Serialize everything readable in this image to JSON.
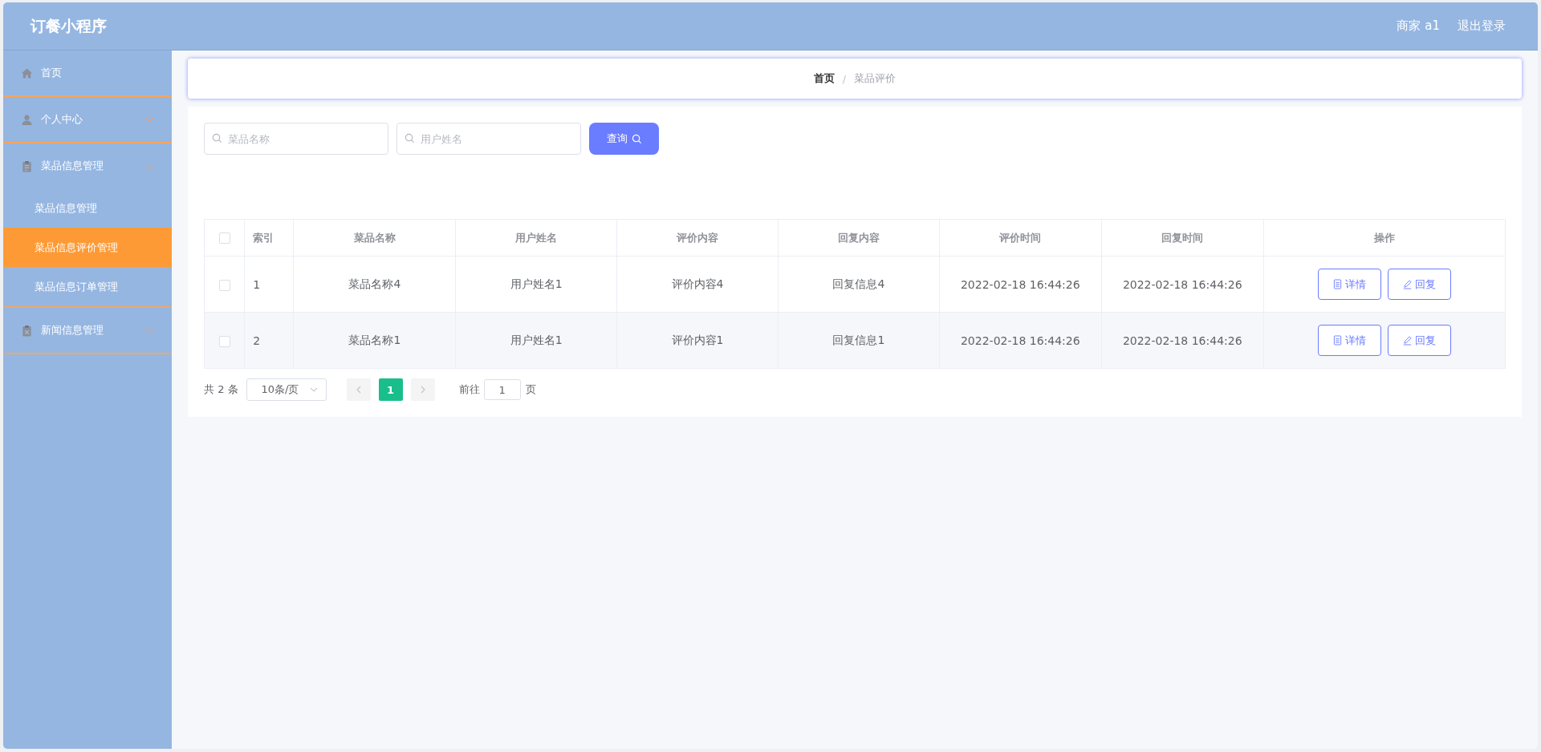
{
  "header": {
    "title": "订餐小程序",
    "user": "商家 a1",
    "logout": "退出登录"
  },
  "sidebar": {
    "items": [
      {
        "label": "首页"
      },
      {
        "label": "个人中心",
        "expanded": false
      },
      {
        "label": "菜品信息管理",
        "expanded": true,
        "children": [
          {
            "label": "菜品信息管理",
            "selected": false
          },
          {
            "label": "菜品信息评价管理",
            "selected": true
          },
          {
            "label": "菜品信息订单管理",
            "selected": false
          }
        ]
      },
      {
        "label": "新闻信息管理",
        "expanded": false
      }
    ]
  },
  "breadcrumb": [
    {
      "label": "首页",
      "current": false
    },
    {
      "label": "菜品评价",
      "current": true
    }
  ],
  "breadcrumb_separator": "/",
  "search": {
    "fields": [
      {
        "placeholder": "菜品名称"
      },
      {
        "placeholder": "用户姓名"
      }
    ],
    "button": "查询"
  },
  "table": {
    "header_checked": false,
    "columns": [
      "索引",
      "菜品名称",
      "用户姓名",
      "评价内容",
      "回复内容",
      "评价时间",
      "回复时间",
      "操作"
    ],
    "rows": [
      {
        "checked": false,
        "cells": [
          "1",
          "菜品名称4",
          "用户姓名1",
          "评价内容4",
          "回复信息4",
          "2022-02-18 16:44:26",
          "2022-02-18 16:44:26"
        ],
        "actions": [
          "详情",
          "回复"
        ]
      },
      {
        "checked": false,
        "cells": [
          "2",
          "菜品名称1",
          "用户姓名1",
          "评价内容1",
          "回复信息1",
          "2022-02-18 16:44:26",
          "2022-02-18 16:44:26"
        ],
        "actions": [
          "详情",
          "回复"
        ]
      }
    ]
  },
  "pagination": {
    "total": "共 2 条",
    "page_size": "10条/页",
    "prev_disabled": true,
    "next_disabled": true,
    "pages": [
      {
        "label": "1",
        "selected": true
      }
    ],
    "goto_label": "前往",
    "goto_value": "1",
    "goto_suffix": "页"
  }
}
